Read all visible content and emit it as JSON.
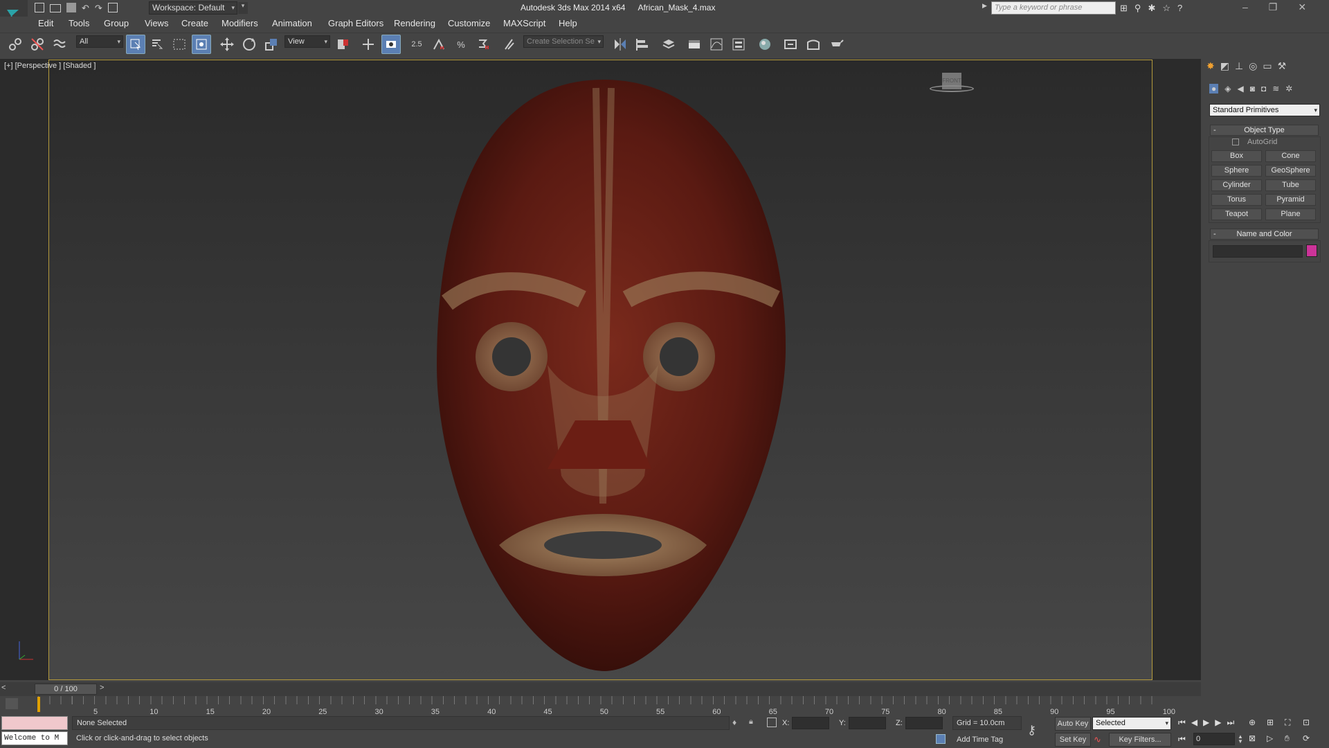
{
  "window": {
    "app_title": "Autodesk 3ds Max  2014 x64",
    "file_name": "African_Mask_4.max",
    "workspace": "Workspace: Default",
    "search_placeholder": "Type a keyword or phrase"
  },
  "menu": [
    "Edit",
    "Tools",
    "Group",
    "Views",
    "Create",
    "Modifiers",
    "Animation",
    "Graph Editors",
    "Rendering",
    "Customize",
    "MAXScript",
    "Help"
  ],
  "toolbar": {
    "selection_filter": "All",
    "ref_coord": "View",
    "snap_value": "2.5",
    "named_selection": "Create Selection Se"
  },
  "viewport": {
    "label": "[+] [Perspective ] [Shaded ]",
    "viewcube_label": "FRONT"
  },
  "command_panel": {
    "category": "Standard Primitives",
    "object_type_header": "Object Type",
    "autogrid": "AutoGrid",
    "buttons": [
      "Box",
      "Cone",
      "Sphere",
      "GeoSphere",
      "Cylinder",
      "Tube",
      "Torus",
      "Pyramid",
      "Teapot",
      "Plane"
    ],
    "name_color_header": "Name and Color",
    "color": "#cc3399"
  },
  "timeline": {
    "frame": "0 / 100",
    "ticks": [
      "5",
      "10",
      "15",
      "20",
      "25",
      "30",
      "35",
      "40",
      "45",
      "50",
      "55",
      "60",
      "65",
      "70",
      "75",
      "80",
      "85",
      "90",
      "95",
      "100"
    ]
  },
  "status": {
    "maxscript": "Welcome to M",
    "selection": "None Selected",
    "prompt": "Click or click-and-drag to select objects",
    "x_label": "X:",
    "y_label": "Y:",
    "z_label": "Z:",
    "grid": "Grid = 10.0cm",
    "add_time_tag": "Add Time Tag",
    "auto_key": "Auto Key",
    "set_key": "Set Key",
    "key_mode": "Selected",
    "key_filters": "Key Filters...",
    "current_frame": "0"
  }
}
